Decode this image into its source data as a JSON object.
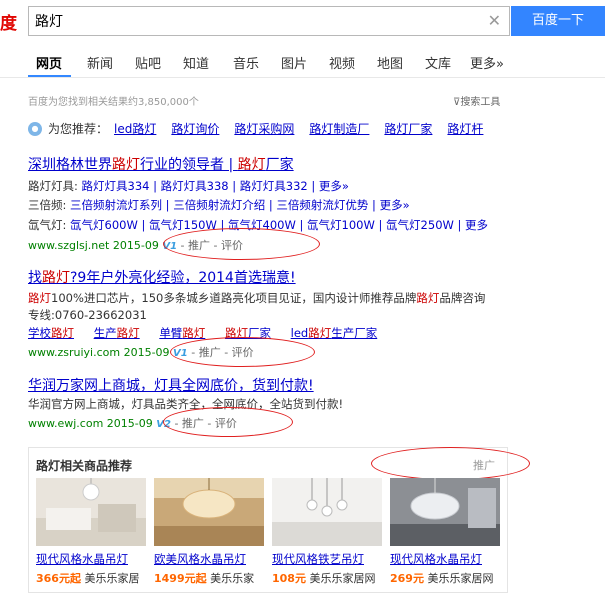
{
  "header": {
    "logo_text": "度",
    "search_value": "路灯",
    "search_button": "百度一下"
  },
  "tabs": [
    "网页",
    "新闻",
    "贴吧",
    "知道",
    "音乐",
    "图片",
    "视频",
    "地图",
    "文库",
    "更多»"
  ],
  "info": {
    "result_count": "百度为您找到相关结果约3,850,000个",
    "search_tools": "搜索工具"
  },
  "recommend": {
    "label": "为您推荐：",
    "items": [
      "led路灯",
      "路灯询价",
      "路灯采购网",
      "路灯制造厂",
      "路灯厂家",
      "路灯杆"
    ]
  },
  "results": [
    {
      "title": "深圳格林世界路灯行业的领导者 | 路灯厂家",
      "lines": [
        {
          "label": "路灯灯具:",
          "text": "路灯灯具334 | 路灯灯具338 | 路灯灯具332 | 更多»"
        },
        {
          "label": "三倍频:",
          "text": "三倍频射流灯系列 | 三倍频射流灯介绍 | 三倍频射流灯优势 | 更多»"
        },
        {
          "label": "氙气灯:",
          "text": "氙气灯600W | 氙气灯150W | 氙气灯400W | 氙气灯100W | 氙气灯250W | 更多"
        }
      ],
      "url": "www.szglsj.net  2015-09",
      "badge": "V1",
      "ad": "- 推广 - 评价"
    },
    {
      "title": "找路灯?9年户外亮化经验，2014首选瑞意!",
      "desc": "路灯100%进口芯片，150多条城乡道路亮化项目见证，国内设计师推荐品牌路灯品牌咨询",
      "phone": "专线:0760-23662031",
      "sublinks": [
        "学校路灯",
        "生产路灯",
        "单臂路灯",
        "路灯厂家",
        "led路灯生产厂家"
      ],
      "url": "www.zsruiyi.com  2015-09",
      "badge": "V1",
      "ad": "- 推广 - 评价"
    },
    {
      "title": "华润万家网上商城，灯具全网底价，货到付款!",
      "desc": "华润官方网上商城，灯具品类齐全，全网底价，全站货到付款!",
      "url": "www.ewj.com  2015-09",
      "badge": "V2",
      "ad": "- 推广 - 评价"
    }
  ],
  "products": {
    "title": "路灯相关商品推荐",
    "ad": "推广",
    "items": [
      {
        "name": "现代风格水晶吊灯",
        "price": "366元起",
        "shop": "美乐乐家居"
      },
      {
        "name": "欧美风格水晶吊灯",
        "price": "1499元起",
        "shop": "美乐乐家"
      },
      {
        "name": "现代风格铁艺吊灯",
        "price": "108元",
        "shop": "美乐乐家居网"
      },
      {
        "name": "现代风格水晶吊灯",
        "price": "269元",
        "shop": "美乐乐家居网"
      }
    ]
  },
  "colors": {
    "brand_red": "#e10602",
    "button_blue": "#3385ff",
    "link_blue": "#0000cc",
    "url_green": "#008000",
    "price_orange": "#ff6600"
  }
}
